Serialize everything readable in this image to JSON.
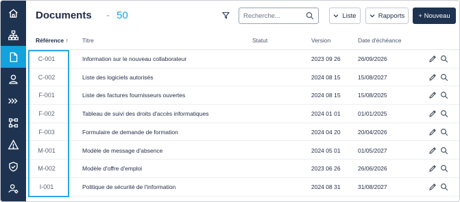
{
  "sidebar": {
    "items": [
      {
        "icon": "home-icon"
      },
      {
        "icon": "org-chart-icon"
      },
      {
        "icon": "document-icon",
        "active": true
      },
      {
        "icon": "user-icon"
      },
      {
        "icon": "process-chevrons-icon"
      },
      {
        "icon": "hierarchy-icon"
      },
      {
        "icon": "warning-icon"
      },
      {
        "icon": "shield-check-icon"
      },
      {
        "icon": "user-settings-icon"
      }
    ]
  },
  "header": {
    "title": "Documents",
    "separator": "-",
    "count": "50"
  },
  "toolbar": {
    "search_placeholder": "Recherche...",
    "liste_label": "Liste",
    "rapports_label": "Rapports",
    "nouveau_label": "+ Nouveau"
  },
  "table": {
    "columns": {
      "reference": "Référence ↑",
      "titre": "Titre",
      "statut": "Statut",
      "version": "Version",
      "echeance": "Date d'échéance"
    },
    "rows": [
      {
        "reference": "C-001",
        "titre": "Information sur le nouveau collaborateur",
        "statut": "",
        "version": "2023 09 26",
        "echeance": "26/09/2026"
      },
      {
        "reference": "C-002",
        "titre": "Liste des logiciels autorisés",
        "statut": "",
        "version": "2024 08 15",
        "echeance": "15/08/2027"
      },
      {
        "reference": "F-001",
        "titre": "Liste des factures fournisseurs ouvertes",
        "statut": "",
        "version": "2024 08 15",
        "echeance": "15/08/2025"
      },
      {
        "reference": "F-002",
        "titre": "Tableau de suivi des droits d'accès informatiques",
        "statut": "",
        "version": "2024 01 01",
        "echeance": "01/01/2025"
      },
      {
        "reference": "F-003",
        "titre": "Formulaire de demande de formation",
        "statut": "",
        "version": "2024 04 20",
        "echeance": "20/04/2026"
      },
      {
        "reference": "M-001",
        "titre": "Modèle de message d'absence",
        "statut": "",
        "version": "2024 05 01",
        "echeance": "01/05/2027"
      },
      {
        "reference": "M-002",
        "titre": "Modèle d'offre d'emploi",
        "statut": "",
        "version": "2023 06 26",
        "echeance": "26/06/2026"
      },
      {
        "reference": "I-001",
        "titre": "Politique de sécurité de l'information",
        "statut": "",
        "version": "2024 08 31",
        "echeance": "31/08/2027"
      }
    ]
  },
  "colors": {
    "sidebar_bg": "#1e3350",
    "active_accent": "#12a2dd",
    "highlight_border": "#29a7e1"
  }
}
